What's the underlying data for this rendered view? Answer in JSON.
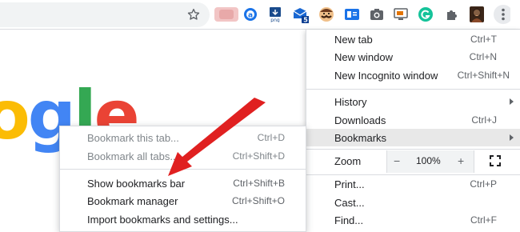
{
  "toolbar": {
    "extensions": [
      {
        "icon": "blurred-avatar-icon",
        "color": "#f2c5c5"
      },
      {
        "icon": "a-circle-icon",
        "color": "#1a73e8"
      },
      {
        "icon": "png-download-icon",
        "color": "#1a4b8c"
      },
      {
        "icon": "mail-badge-icon",
        "color": "#1967d2",
        "badge": "5"
      },
      {
        "icon": "mustache-face-icon",
        "color": "#6d3b1e"
      },
      {
        "icon": "reader-card-icon",
        "color": "#1a73e8"
      },
      {
        "icon": "camera-icon",
        "color": "#5f6368"
      },
      {
        "icon": "screen-cast-icon",
        "color": "#e37400"
      },
      {
        "icon": "grammarly-icon",
        "color": "#15c39a"
      },
      {
        "icon": "puzzle-extensions-icon",
        "color": "#5f6368"
      },
      {
        "icon": "profile-avatar-icon",
        "color": "#8a4a2a"
      },
      {
        "icon": "kebab-menu-icon",
        "color": "#5f6368"
      }
    ]
  },
  "logo": {
    "letters": [
      {
        "ch": "o",
        "color": "#fbbc05"
      },
      {
        "ch": "g",
        "color": "#4285f4"
      },
      {
        "ch": "l",
        "color": "#34a853"
      },
      {
        "ch": "e",
        "color": "#ea4335"
      }
    ]
  },
  "menu": {
    "new_tab": {
      "label": "New tab",
      "shortcut": "Ctrl+T"
    },
    "new_window": {
      "label": "New window",
      "shortcut": "Ctrl+N"
    },
    "new_incognito": {
      "label": "New Incognito window",
      "shortcut": "Ctrl+Shift+N"
    },
    "history": {
      "label": "History"
    },
    "downloads": {
      "label": "Downloads",
      "shortcut": "Ctrl+J"
    },
    "bookmarks": {
      "label": "Bookmarks"
    },
    "zoom": {
      "label": "Zoom",
      "minus": "−",
      "value": "100%",
      "plus": "+"
    },
    "print": {
      "label": "Print...",
      "shortcut": "Ctrl+P"
    },
    "cast": {
      "label": "Cast..."
    },
    "find": {
      "label": "Find...",
      "shortcut": "Ctrl+F"
    }
  },
  "submenu": {
    "bookmark_tab": {
      "label": "Bookmark this tab...",
      "shortcut": "Ctrl+D"
    },
    "bookmark_all": {
      "label": "Bookmark all tabs...",
      "shortcut": "Ctrl+Shift+D"
    },
    "show_bar": {
      "label": "Show bookmarks bar",
      "shortcut": "Ctrl+Shift+B"
    },
    "manager": {
      "label": "Bookmark manager",
      "shortcut": "Ctrl+Shift+O"
    },
    "import": {
      "label": "Import bookmarks and settings..."
    }
  },
  "colors": {
    "accent_red": "#e02020",
    "highlight": "#e8e8e8"
  }
}
